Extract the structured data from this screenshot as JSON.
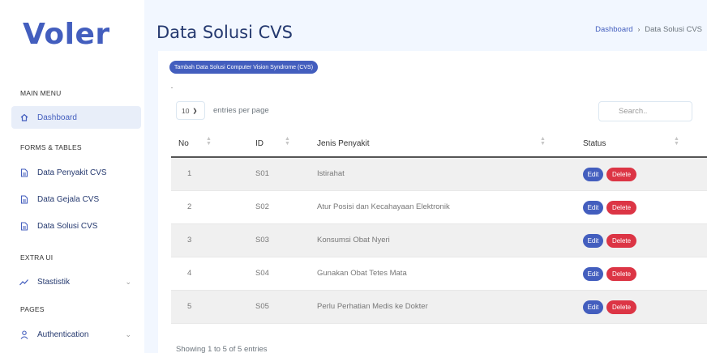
{
  "brand": {
    "name": "Voler",
    "color": "#435ebe"
  },
  "sidebar": {
    "sections": [
      {
        "title": "MAIN MENU"
      },
      {
        "title": "FORMS & TABLES"
      },
      {
        "title": "EXTRA UI"
      },
      {
        "title": "PAGES"
      }
    ],
    "items": [
      {
        "label": "Dashboard",
        "icon": "home-icon",
        "active": true
      },
      {
        "label": "Data Penyakit CVS",
        "icon": "file-icon"
      },
      {
        "label": "Data Gejala CVS",
        "icon": "file-icon"
      },
      {
        "label": "Data Solusi CVS",
        "icon": "file-icon"
      },
      {
        "label": "Stastistik",
        "icon": "chart-icon",
        "has_submenu": true
      },
      {
        "label": "Authentication",
        "icon": "user-icon",
        "has_submenu": true
      }
    ]
  },
  "header": {
    "title": "Data Solusi CVS",
    "breadcrumb": [
      "Dashboard",
      "Data Solusi CVS"
    ]
  },
  "toolbar": {
    "add_label": "Tambah Data Solusi Computer Vision Syndrome (CVS)",
    "page_size": "10",
    "entries_label": "entries per page",
    "search_placeholder": "Search.."
  },
  "table": {
    "columns": [
      "No",
      "ID",
      "Jenis Penyakit",
      "Status"
    ],
    "rows": [
      {
        "no": "1",
        "id": "S01",
        "name": "Istirahat"
      },
      {
        "no": "2",
        "id": "S02",
        "name": "Atur Posisi dan Kecahayaan Elektronik"
      },
      {
        "no": "3",
        "id": "S03",
        "name": "Konsumsi Obat Nyeri"
      },
      {
        "no": "4",
        "id": "S04",
        "name": "Gunakan Obat Tetes Mata"
      },
      {
        "no": "5",
        "id": "S05",
        "name": "Perlu Perhatian Medis ke Dokter"
      }
    ],
    "edit_label": "Edit",
    "delete_label": "Delete"
  },
  "footer": {
    "info": "Showing 1 to 5 of 5 entries"
  },
  "colors": {
    "primary": "#435ebe",
    "danger": "#dc3545",
    "background": "#f2f7ff"
  }
}
